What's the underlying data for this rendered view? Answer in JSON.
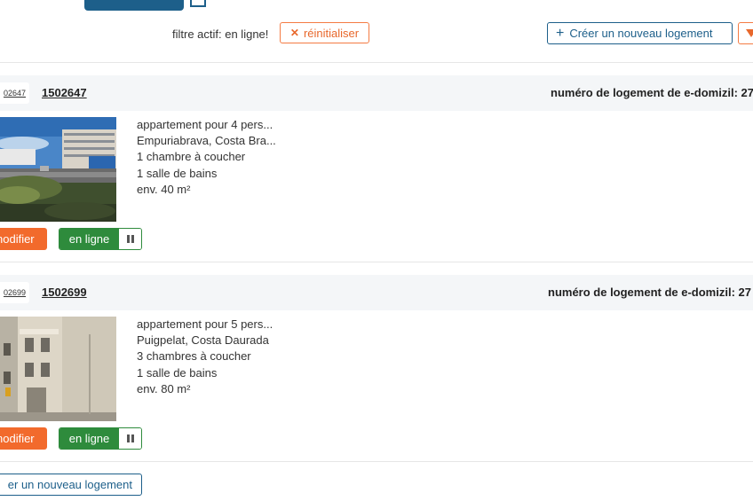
{
  "toolbar": {
    "active_filter_text": "filtre actif: en ligne!",
    "reset_label": "réinitialiser",
    "create_label": "Créer un nouveau logement"
  },
  "listings": [
    {
      "id_short": "02647",
      "id": "1502647",
      "edomizil_label": "numéro de logement de e-domizil: 27",
      "type": "appartement pour 4 pers...",
      "location": "Empuriabrava, Costa Bra...",
      "bedrooms": "1 chambre à coucher",
      "bathrooms": "1 salle de bains",
      "area": "env. 40 m²",
      "edit_label": "nodifier",
      "status_label": "en ligne"
    },
    {
      "id_short": "02699",
      "id": "1502699",
      "edomizil_label": "numéro de logement de e-domizil: 27",
      "type": "appartement pour 5 pers...",
      "location": "Puigpelat, Costa Daurada",
      "bedrooms": "3 chambres à coucher",
      "bathrooms": "1 salle de bains",
      "area": "env. 80 m²",
      "edit_label": "nodifier",
      "status_label": "en ligne"
    }
  ],
  "bottom": {
    "create_label": "er un nouveau logement"
  },
  "colors": {
    "primary": "#1d5f8a",
    "accent": "#f26a2c",
    "online": "#2e8b3c",
    "header_bg": "#f4f6f8"
  },
  "icons": {
    "reset": "close-icon",
    "create": "plus-icon",
    "filter": "filter-icon",
    "pause": "pause-icon"
  }
}
